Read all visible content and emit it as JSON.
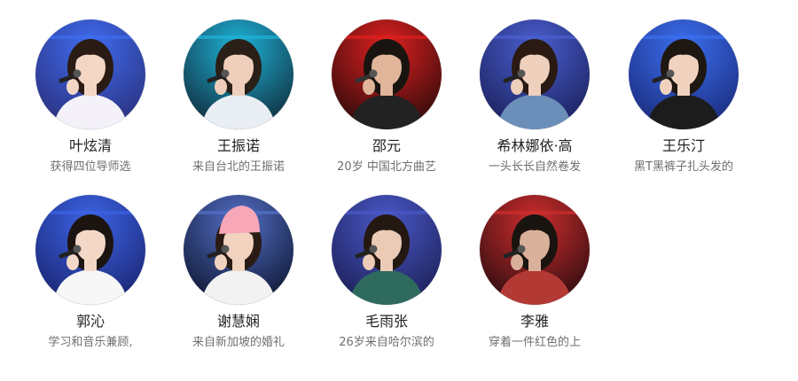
{
  "contestants": [
    {
      "name": "叶炫清",
      "desc": "获得四位导师选",
      "bg": "#2a2f7a",
      "light": "#3f6cf0",
      "hair": "#2a1b14",
      "skin": "#f3d6c4",
      "top": "#f4f2f8",
      "mic": "#222222",
      "avatar": "contestant-portrait-icon"
    },
    {
      "name": "王振诺",
      "desc": "来自台北的王振诺",
      "bg": "#0f2a3a",
      "light": "#1fb3d8",
      "hair": "#2a2018",
      "skin": "#efcfbb",
      "top": "#e9eef4",
      "mic": "#222222",
      "avatar": "contestant-portrait-icon"
    },
    {
      "name": "邵元",
      "desc": "20岁 中国北方曲艺",
      "bg": "#2a0a0a",
      "light": "#e02020",
      "hair": "#1a1410",
      "skin": "#e0b59a",
      "top": "#222222",
      "mic": "#333333",
      "avatar": "contestant-portrait-icon"
    },
    {
      "name": "希林娜依·高",
      "desc": "一头长长自然卷发",
      "bg": "#1a1f5a",
      "light": "#4a5fd0",
      "hair": "#2a1a12",
      "skin": "#eed0bd",
      "top": "#6b8fb8",
      "mic": "#222222",
      "avatar": "contestant-portrait-icon"
    },
    {
      "name": "王乐汀",
      "desc": "黑T黑裤子扎头发的",
      "bg": "#1a2a7a",
      "light": "#3b6ff0",
      "hair": "#1e1712",
      "skin": "#f0d2bf",
      "top": "#1c1c1c",
      "mic": "#222222",
      "avatar": "contestant-portrait-icon"
    },
    {
      "name": "郭沁",
      "desc": "学习和音乐兼顾,",
      "bg": "#1a2470",
      "light": "#3c64e6",
      "hair": "#1c1410",
      "skin": "#f4d8c7",
      "top": "#f7f7f7",
      "mic": "#222222",
      "avatar": "contestant-portrait-icon"
    },
    {
      "name": "谢慧娴",
      "desc": "来自新加坡的婚礼",
      "bg": "#0d1530",
      "light": "#5470c8",
      "hair": "#2a1c14",
      "skin": "#f2d3c0",
      "top": "#f2f2f2",
      "mic": "#222222",
      "hat": "#f7a7b8",
      "avatar": "contestant-portrait-icon"
    },
    {
      "name": "毛雨张",
      "desc": "26岁来自哈尔滨的",
      "bg": "#1b1f55",
      "light": "#4a58c8",
      "hair": "#241812",
      "skin": "#eccbb6",
      "top": "#2f6a5e",
      "mic": "#222222",
      "avatar": "contestant-portrait-icon"
    },
    {
      "name": "李雅",
      "desc": "穿着一件红色的上",
      "bg": "#2a0c10",
      "light": "#d02d2d",
      "hair": "#1a1410",
      "skin": "#d9b09a",
      "top": "#b33a34",
      "mic": "#222222",
      "avatar": "contestant-portrait-icon"
    }
  ]
}
